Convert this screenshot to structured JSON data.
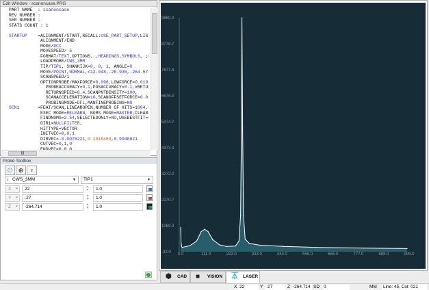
{
  "edit_window": {
    "title": "Edit Window - scanoncase.PRG",
    "lines": [
      [
        [
          "PART NAME  : ",
          ""
        ],
        [
          "scanoncase",
          "b"
        ]
      ],
      [
        [
          "REV NUMBER :",
          ""
        ]
      ],
      [
        [
          "SER NUMBER :",
          ""
        ]
      ],
      [
        [
          "STATS COUNT : ",
          ""
        ],
        [
          "1",
          "b"
        ]
      ],
      [
        [
          "",
          ""
        ]
      ],
      [
        [
          "STARTUP",
          "b"
        ],
        [
          "    =ALIGNMENT/START,RECALL:",
          ""
        ],
        [
          "USE_PART_SETUP",
          "b"
        ],
        [
          ",LIST",
          ""
        ]
      ],
      [
        [
          "            ALIGNMENT/END",
          ""
        ]
      ],
      [
        [
          "            MODE/",
          ""
        ],
        [
          "DCC",
          "b"
        ]
      ],
      [
        [
          "            MOVESPEED/ ",
          ""
        ],
        [
          "5",
          "b"
        ]
      ],
      [
        [
          "            FORMAT/",
          ""
        ],
        [
          "TEXT",
          "b"
        ],
        [
          ",OPTIONS, ,",
          ""
        ],
        [
          "HEADINGS",
          "b"
        ],
        [
          ",",
          ""
        ],
        [
          "SYMBOLS",
          "b"
        ],
        [
          ", ;N",
          ""
        ]
      ],
      [
        [
          "            LOADPROBE/",
          ""
        ],
        [
          "CWS_3MM",
          "b"
        ]
      ],
      [
        [
          "            TIP/",
          ""
        ],
        [
          "TIP1",
          "b"
        ],
        [
          ", SHANKIJK=",
          ""
        ],
        [
          "0",
          "b"
        ],
        [
          ", ",
          ""
        ],
        [
          "0",
          "b"
        ],
        [
          ", ",
          ""
        ],
        [
          "1",
          "b"
        ],
        [
          ", ANGLE=",
          ""
        ],
        [
          "0",
          "b"
        ]
      ],
      [
        [
          "            MOVE/",
          ""
        ],
        [
          "POINT",
          "b"
        ],
        [
          ",",
          ""
        ],
        [
          "NORMAL",
          "b"
        ],
        [
          ",<",
          ""
        ],
        [
          "12.048",
          "b"
        ],
        [
          ",",
          ""
        ],
        [
          "-26.935",
          "b"
        ],
        [
          ",",
          ""
        ],
        [
          "-264.574",
          "b"
        ]
      ],
      [
        [
          "            SCANSPEED/",
          ""
        ],
        [
          "1",
          "b"
        ]
      ],
      [
        [
          "            OPTIONPROBE/MAXFORCE=",
          ""
        ],
        [
          "0.096",
          "b"
        ],
        [
          ",LOWFORCE=",
          ""
        ],
        [
          "0.019",
          "b"
        ],
        [
          ",",
          ""
        ]
      ],
      [
        [
          "              PROBEACCURACY=",
          ""
        ],
        [
          "0.1",
          "b"
        ],
        [
          ",POSACCURACY=",
          ""
        ],
        [
          "0.1",
          "b"
        ],
        [
          ",#RETUR",
          ""
        ]
      ],
      [
        [
          "              RETURNSPEED=",
          ""
        ],
        [
          "0.4",
          "b"
        ],
        [
          ",SCANPNTDENSITY=",
          ""
        ],
        [
          "100",
          "b"
        ],
        [
          ",",
          ""
        ]
      ],
      [
        [
          "              SCANACCELERATION=",
          ""
        ],
        [
          "10",
          "b"
        ],
        [
          ",SCANOFFSETFORCE=",
          ""
        ],
        [
          "0.06",
          "b"
        ]
      ],
      [
        [
          "              PROBINGMODE=",
          ""
        ],
        [
          "DFL",
          "b"
        ],
        [
          ",MANFINEPROBING=",
          ""
        ],
        [
          "NO",
          "b"
        ]
      ],
      [
        [
          "SCN1",
          "b"
        ],
        [
          "       =FEAT/SCAN,LINEAROPEN,NUMBER OF HITS=",
          ""
        ],
        [
          "1004",
          "b"
        ],
        [
          ",S",
          ""
        ]
      ],
      [
        [
          "            EXEC MODE=",
          ""
        ],
        [
          "RELEARN",
          "b"
        ],
        [
          ", NOMS MODE=",
          ""
        ],
        [
          "MASTER",
          "b"
        ],
        [
          ",CLEARP",
          ""
        ]
      ],
      [
        [
          "            FINDNOMS=",
          ""
        ],
        [
          "2.54",
          "b"
        ],
        [
          ",SELECTEDONLY=",
          ""
        ],
        [
          "NO",
          "b"
        ],
        [
          ",USEBESTFIT=",
          ""
        ],
        [
          "N",
          "b"
        ]
      ],
      [
        [
          "            DIR1=",
          ""
        ],
        [
          "NULLFILTER",
          "b"
        ],
        [
          ",",
          ""
        ]
      ],
      [
        [
          "            HITTYPE=VECTOR",
          ""
        ]
      ],
      [
        [
          "            INITVEC=",
          ""
        ],
        [
          "0",
          "b"
        ],
        [
          ",",
          ""
        ],
        [
          "0",
          "b"
        ],
        [
          ",",
          ""
        ],
        [
          "1",
          "b"
        ]
      ],
      [
        [
          "            DIRVEC=",
          ""
        ],
        [
          "-0.0075221",
          "b"
        ],
        [
          ",",
          ""
        ],
        [
          "0.1015488",
          "o"
        ],
        [
          ",",
          ""
        ],
        [
          "0.9948021",
          "b"
        ]
      ],
      [
        [
          "            CUTVEC=",
          ""
        ],
        [
          "0",
          "b"
        ],
        [
          ",",
          ""
        ],
        [
          "1",
          "b"
        ],
        [
          ",",
          ""
        ],
        [
          "0",
          "b"
        ]
      ],
      [
        [
          "            ENDVEC=0,0,0",
          ""
        ]
      ]
    ]
  },
  "probe_toolbox": {
    "title": "Probe Toolbox",
    "probe": "CWS_3MM",
    "tip": "TIP1",
    "rows": [
      {
        "axis": "X",
        "value": "22",
        "step": "1.0"
      },
      {
        "axis": "Y",
        "value": "-27",
        "step": "1.0"
      },
      {
        "axis": "Z",
        "value": "-264.714",
        "step": "1.0"
      }
    ]
  },
  "chart_data": {
    "type": "line",
    "title": "",
    "xlabel": "",
    "ylabel": "",
    "xlim": [
      0,
      999
    ],
    "ylim": [
      -32,
      9880
    ],
    "xticks": [
      "0.0",
      "111.0",
      "222.0",
      "333.0",
      "444.0",
      "555.0",
      "666.0",
      "777.0",
      "888.0",
      "999.0"
    ],
    "yticks": [
      "-32.0",
      "1069.3",
      "2170.7",
      "3272.0",
      "4373.3",
      "5474.7",
      "6576.0",
      "7677.3",
      "8778.7",
      "9880.0"
    ],
    "background": "#162d37",
    "line_color": "#ffffff",
    "fill_color": "#2a6a78",
    "x": [
      0,
      2,
      6,
      40,
      70,
      90,
      105,
      120,
      140,
      170,
      200,
      240,
      255,
      262,
      266,
      268,
      271,
      275,
      282,
      300,
      350,
      450,
      600,
      800,
      990
    ],
    "y": [
      1000,
      300,
      150,
      220,
      420,
      820,
      920,
      820,
      480,
      260,
      190,
      210,
      420,
      1500,
      5200,
      9880,
      5200,
      1500,
      500,
      320,
      240,
      190,
      150,
      120,
      100
    ]
  },
  "tabs": [
    {
      "label": "CAD"
    },
    {
      "label": "VISION"
    },
    {
      "label": "LASER",
      "active": true
    }
  ],
  "status": {
    "x_label": "X",
    "x": "22",
    "y_label": "Y",
    "y": "-27",
    "z_label": "Z",
    "z": "-264.714",
    "sd_label": "SD",
    "sd": "0",
    "units": "MM",
    "position": "Line: 45, Col: 021"
  }
}
